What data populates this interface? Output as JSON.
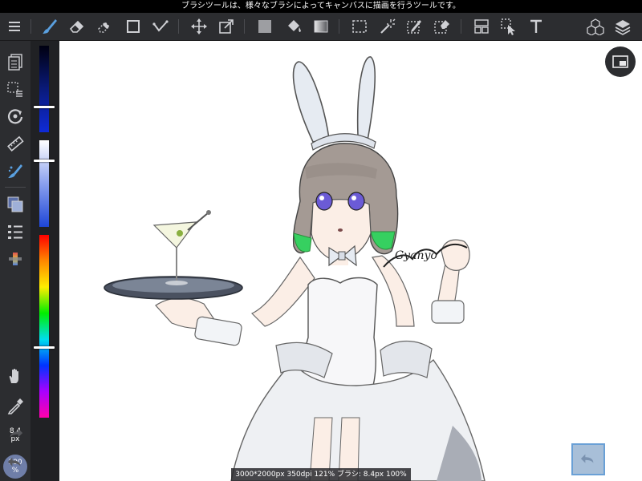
{
  "status_bar": {
    "hint": "ブラシツールは、様々なブラシによってキャンバスに描画を行うツールです。"
  },
  "toolbar": {
    "items": [
      {
        "icon": "menu-icon"
      },
      {
        "icon": "brush-icon"
      },
      {
        "icon": "eraser-icon"
      },
      {
        "icon": "selection-eraser-icon"
      },
      {
        "icon": "shape-icon"
      },
      {
        "icon": "correction-icon"
      },
      {
        "icon": "move-icon"
      },
      {
        "icon": "transform-icon"
      },
      {
        "icon": "fill-color-icon"
      },
      {
        "icon": "bucket-icon"
      },
      {
        "icon": "gradient-icon"
      },
      {
        "icon": "select-icon"
      },
      {
        "icon": "magic-wand-icon"
      },
      {
        "icon": "select-pen-icon"
      },
      {
        "icon": "select-eraser-icon"
      },
      {
        "icon": "frame-divider-icon"
      },
      {
        "icon": "operation-icon"
      },
      {
        "icon": "text-icon"
      },
      {
        "icon": "material-icon"
      },
      {
        "icon": "layers-icon"
      }
    ],
    "active_color": "#5aa0e0"
  },
  "left_tools": {
    "size_value": "8.4",
    "size_unit": "px",
    "zoom_value": "100",
    "zoom_unit": "%"
  },
  "canvas": {
    "signature_text": "Gyanyo",
    "info": "3000*2000px 350dpi 121% ブラシ: 8.4px 100%"
  }
}
